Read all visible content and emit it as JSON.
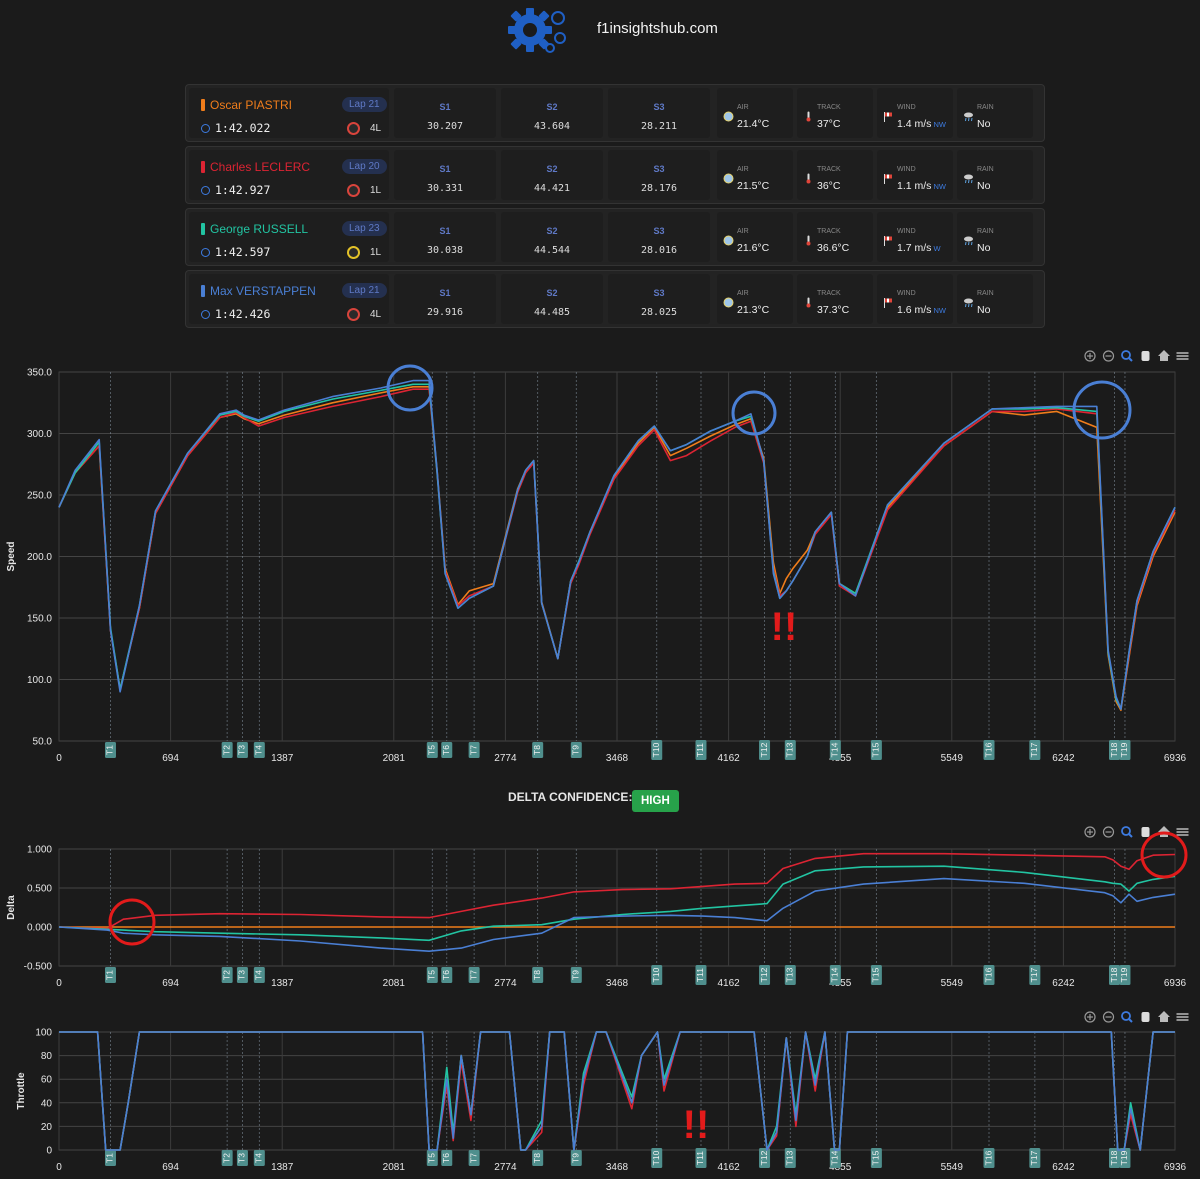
{
  "site": {
    "title": "f1insightshub.com"
  },
  "drivers": [
    {
      "name": "Oscar PIASTRI",
      "color": "#f07d1b",
      "lap": "Lap 21",
      "time": "1:42.022",
      "tyre": "soft",
      "tyre_label": "4L",
      "s1": "30.207",
      "s2": "43.604",
      "s3": "28.211",
      "air": "21.4°C",
      "track": "37°C",
      "wind": "1.4 m/s",
      "wind_dir": "NW",
      "rain": "No"
    },
    {
      "name": "Charles LECLERC",
      "color": "#dc2433",
      "lap": "Lap 20",
      "time": "1:42.927",
      "tyre": "soft",
      "tyre_label": "1L",
      "s1": "30.331",
      "s2": "44.421",
      "s3": "28.176",
      "air": "21.5°C",
      "track": "36°C",
      "wind": "1.1 m/s",
      "wind_dir": "NW",
      "rain": "No"
    },
    {
      "name": "George RUSSELL",
      "color": "#22c4a2",
      "lap": "Lap 23",
      "time": "1:42.597",
      "tyre": "medium",
      "tyre_label": "1L",
      "s1": "30.038",
      "s2": "44.544",
      "s3": "28.016",
      "air": "21.6°C",
      "track": "36.6°C",
      "wind": "1.7 m/s",
      "wind_dir": "W",
      "rain": "No"
    },
    {
      "name": "Max VERSTAPPEN",
      "color": "#4a7fd4",
      "lap": "Lap 21",
      "time": "1:42.426",
      "tyre": "soft",
      "tyre_label": "4L",
      "s1": "29.916",
      "s2": "44.485",
      "s3": "28.025",
      "air": "21.3°C",
      "track": "37.3°C",
      "wind": "1.6 m/s",
      "wind_dir": "NW",
      "rain": "No"
    }
  ],
  "labels": {
    "s1": "S1",
    "s2": "S2",
    "s3": "S3",
    "air": "AIR",
    "track": "TRACK",
    "wind": "WIND",
    "rain": "RAIN"
  },
  "delta_confidence": {
    "label": "DELTA CONFIDENCE:",
    "value": "HIGH"
  },
  "toolbar_icons": [
    "zoom-in-icon",
    "zoom-out-icon",
    "magnifier-icon",
    "pan-hand-icon",
    "home-icon",
    "menu-icon"
  ],
  "annotations": {
    "exclamation": "!!"
  },
  "chart_data": [
    {
      "type": "line",
      "id": "speed",
      "ylabel": "Speed",
      "ylim": [
        50,
        350
      ],
      "yticks": [
        "350.0",
        "300.0",
        "250.0",
        "200.0",
        "150.0",
        "100.0",
        "50.0"
      ],
      "xlim": [
        0,
        6936
      ],
      "xticks": [
        "0",
        "694",
        "1387",
        "2081",
        "2774",
        "3468",
        "4162",
        "4855",
        "5549",
        "6242",
        "6936"
      ],
      "corners": [
        {
          "label": "T1",
          "x": 320
        },
        {
          "label": "T2",
          "x": 1045
        },
        {
          "label": "T3",
          "x": 1140
        },
        {
          "label": "T4",
          "x": 1245
        },
        {
          "label": "T5",
          "x": 2320
        },
        {
          "label": "T6",
          "x": 2410
        },
        {
          "label": "T7",
          "x": 2580
        },
        {
          "label": "T8",
          "x": 2975
        },
        {
          "label": "T9",
          "x": 3215
        },
        {
          "label": "T10",
          "x": 3715
        },
        {
          "label": "T11",
          "x": 3990
        },
        {
          "label": "T12",
          "x": 4385
        },
        {
          "label": "T13",
          "x": 4545
        },
        {
          "label": "T14",
          "x": 4825
        },
        {
          "label": "T15",
          "x": 5080
        },
        {
          "label": "T16",
          "x": 5780
        },
        {
          "label": "T17",
          "x": 6065
        },
        {
          "label": "T18",
          "x": 6560
        },
        {
          "label": "T19",
          "x": 6625
        }
      ],
      "x": [
        0,
        100,
        250,
        320,
        380,
        500,
        600,
        800,
        1000,
        1100,
        1150,
        1240,
        1400,
        1700,
        2000,
        2200,
        2300,
        2350,
        2400,
        2480,
        2550,
        2700,
        2850,
        2900,
        2950,
        3000,
        3100,
        3180,
        3230,
        3300,
        3450,
        3600,
        3700,
        3800,
        3900,
        4050,
        4200,
        4300,
        4380,
        4440,
        4480,
        4520,
        4560,
        4650,
        4700,
        4800,
        4850,
        4950,
        5150,
        5500,
        5800,
        6000,
        6200,
        6450,
        6520,
        6570,
        6600,
        6650,
        6700,
        6800,
        6936
      ],
      "series": [
        {
          "name": "Oscar PIASTRI",
          "color": "#f07d1b",
          "values": [
            240,
            268,
            290,
            140,
            92,
            158,
            235,
            282,
            313,
            316,
            312,
            308,
            315,
            325,
            333,
            338,
            338,
            270,
            190,
            161,
            172,
            178,
            255,
            270,
            278,
            163,
            117,
            180,
            195,
            220,
            265,
            292,
            305,
            282,
            288,
            298,
            307,
            312,
            280,
            195,
            170,
            182,
            190,
            205,
            220,
            236,
            178,
            170,
            240,
            290,
            318,
            315,
            318,
            305,
            120,
            82,
            75,
            118,
            160,
            200,
            236
          ]
        },
        {
          "name": "Charles LECLERC",
          "color": "#dc2433",
          "values": [
            240,
            268,
            290,
            140,
            92,
            158,
            235,
            282,
            313,
            317,
            313,
            306,
            313,
            322,
            330,
            336,
            336,
            268,
            188,
            160,
            168,
            176,
            252,
            268,
            276,
            162,
            117,
            178,
            193,
            218,
            263,
            290,
            303,
            278,
            282,
            294,
            305,
            310,
            276,
            190,
            168,
            172,
            180,
            200,
            218,
            234,
            176,
            168,
            238,
            290,
            318,
            318,
            320,
            316,
            122,
            84,
            76,
            120,
            162,
            202,
            238
          ]
        },
        {
          "name": "George RUSSELL",
          "color": "#22c4a2",
          "values": [
            240,
            268,
            293,
            142,
            92,
            160,
            237,
            284,
            315,
            318,
            314,
            310,
            318,
            328,
            335,
            340,
            340,
            268,
            186,
            158,
            166,
            176,
            254,
            270,
            278,
            162,
            117,
            180,
            196,
            220,
            266,
            294,
            306,
            286,
            291,
            302,
            310,
            314,
            278,
            188,
            166,
            172,
            180,
            200,
            220,
            236,
            178,
            170,
            242,
            292,
            320,
            320,
            321,
            318,
            122,
            84,
            76,
            122,
            164,
            204,
            240
          ]
        },
        {
          "name": "Max VERSTAPPEN",
          "color": "#4a7fd4",
          "values": [
            240,
            270,
            295,
            140,
            90,
            160,
            237,
            284,
            316,
            319,
            315,
            311,
            319,
            330,
            337,
            343,
            343,
            270,
            186,
            158,
            166,
            176,
            254,
            270,
            278,
            162,
            117,
            180,
            195,
            220,
            266,
            294,
            306,
            286,
            291,
            302,
            310,
            316,
            278,
            186,
            166,
            172,
            180,
            200,
            220,
            236,
            178,
            168,
            242,
            292,
            320,
            321,
            322,
            322,
            124,
            86,
            76,
            122,
            164,
            204,
            240
          ]
        }
      ]
    },
    {
      "type": "line",
      "id": "delta",
      "ylabel": "Delta",
      "ylim": [
        -0.5,
        1.0
      ],
      "yticks": [
        "1.000",
        "0.500",
        "0.000",
        "-0.500"
      ],
      "xlim": [
        0,
        6936
      ],
      "xticks": [
        "0",
        "694",
        "1387",
        "2081",
        "2774",
        "3468",
        "4162",
        "4855",
        "5549",
        "6242",
        "6936"
      ],
      "corners": [
        {
          "label": "T1",
          "x": 320
        },
        {
          "label": "T2",
          "x": 1045
        },
        {
          "label": "T3",
          "x": 1140
        },
        {
          "label": "T4",
          "x": 1245
        },
        {
          "label": "T5",
          "x": 2320
        },
        {
          "label": "T6",
          "x": 2410
        },
        {
          "label": "T7",
          "x": 2580
        },
        {
          "label": "T8",
          "x": 2975
        },
        {
          "label": "T9",
          "x": 3215
        },
        {
          "label": "T10",
          "x": 3715
        },
        {
          "label": "T11",
          "x": 3990
        },
        {
          "label": "T12",
          "x": 4385
        },
        {
          "label": "T13",
          "x": 4545
        },
        {
          "label": "T14",
          "x": 4825
        },
        {
          "label": "T15",
          "x": 5080
        },
        {
          "label": "T16",
          "x": 5780
        },
        {
          "label": "T17",
          "x": 6065
        },
        {
          "label": "T18",
          "x": 6560
        },
        {
          "label": "T19",
          "x": 6625
        }
      ],
      "x": [
        0,
        300,
        400,
        600,
        1000,
        1500,
        2000,
        2300,
        2500,
        2700,
        3000,
        3200,
        3500,
        3800,
        4000,
        4200,
        4400,
        4500,
        4700,
        5000,
        5500,
        6000,
        6500,
        6550,
        6600,
        6650,
        6700,
        6800,
        6936
      ],
      "series": [
        {
          "name": "Oscar PIASTRI",
          "color": "#f07d1b",
          "values": [
            0,
            0,
            0,
            0,
            0,
            0,
            0,
            0,
            0,
            0,
            0,
            0,
            0,
            0,
            0,
            0,
            0,
            0,
            0,
            0,
            0,
            0,
            0,
            0,
            0,
            0,
            0,
            0,
            0
          ]
        },
        {
          "name": "Charles LECLERC",
          "color": "#dc2433",
          "values": [
            0,
            -0.02,
            0.1,
            0.15,
            0.17,
            0.16,
            0.13,
            0.12,
            0.2,
            0.28,
            0.37,
            0.45,
            0.48,
            0.49,
            0.52,
            0.55,
            0.56,
            0.75,
            0.88,
            0.94,
            0.94,
            0.92,
            0.9,
            0.86,
            0.78,
            0.74,
            0.85,
            0.92,
            0.93
          ]
        },
        {
          "name": "George RUSSELL",
          "color": "#22c4a2",
          "values": [
            0,
            -0.03,
            -0.04,
            -0.06,
            -0.08,
            -0.1,
            -0.14,
            -0.17,
            -0.05,
            0.01,
            0.03,
            0.1,
            0.16,
            0.2,
            0.24,
            0.27,
            0.3,
            0.55,
            0.72,
            0.77,
            0.78,
            0.7,
            0.58,
            0.56,
            0.55,
            0.46,
            0.56,
            0.61,
            0.65
          ]
        },
        {
          "name": "Max VERSTAPPEN",
          "color": "#4a7fd4",
          "values": [
            0,
            -0.04,
            -0.08,
            -0.1,
            -0.12,
            -0.18,
            -0.27,
            -0.31,
            -0.27,
            -0.16,
            -0.08,
            0.12,
            0.14,
            0.15,
            0.14,
            0.12,
            0.08,
            0.24,
            0.46,
            0.55,
            0.62,
            0.56,
            0.44,
            0.4,
            0.31,
            0.42,
            0.33,
            0.38,
            0.42
          ]
        }
      ]
    },
    {
      "type": "line",
      "id": "throttle",
      "ylabel": "Throttle",
      "ylim": [
        0,
        100
      ],
      "yticks": [
        "100",
        "80",
        "60",
        "40",
        "20",
        "0"
      ],
      "xlim": [
        0,
        6936
      ],
      "xticks": [
        "0",
        "694",
        "1387",
        "2081",
        "2774",
        "3468",
        "4162",
        "4855",
        "5549",
        "6242",
        "6936"
      ],
      "corners": [
        {
          "label": "T1",
          "x": 320
        },
        {
          "label": "T2",
          "x": 1045
        },
        {
          "label": "T3",
          "x": 1140
        },
        {
          "label": "T4",
          "x": 1245
        },
        {
          "label": "T5",
          "x": 2320
        },
        {
          "label": "T6",
          "x": 2410
        },
        {
          "label": "T7",
          "x": 2580
        },
        {
          "label": "T8",
          "x": 2975
        },
        {
          "label": "T9",
          "x": 3215
        },
        {
          "label": "T10",
          "x": 3715
        },
        {
          "label": "T11",
          "x": 3990
        },
        {
          "label": "T12",
          "x": 4385
        },
        {
          "label": "T13",
          "x": 4545
        },
        {
          "label": "T14",
          "x": 4825
        },
        {
          "label": "T15",
          "x": 5080
        },
        {
          "label": "T16",
          "x": 5780
        },
        {
          "label": "T17",
          "x": 6065
        },
        {
          "label": "T18",
          "x": 6560
        },
        {
          "label": "T19",
          "x": 6625
        }
      ],
      "x": [
        0,
        240,
        290,
        380,
        430,
        500,
        2260,
        2300,
        2350,
        2410,
        2450,
        2500,
        2560,
        2620,
        2800,
        2870,
        2900,
        3000,
        3050,
        3140,
        3200,
        3260,
        3340,
        3400,
        3560,
        3620,
        3720,
        3760,
        3860,
        4320,
        4400,
        4460,
        4520,
        4580,
        4640,
        4700,
        4760,
        4820,
        4850,
        4900,
        6540,
        6580,
        6620,
        6660,
        6720,
        6800,
        6936
      ],
      "series": [
        {
          "name": "Oscar PIASTRI",
          "color": "#f07d1b",
          "values": [
            100,
            100,
            0,
            0,
            40,
            100,
            100,
            0,
            0,
            60,
            10,
            80,
            30,
            100,
            100,
            0,
            0,
            20,
            100,
            100,
            0,
            60,
            100,
            100,
            40,
            80,
            100,
            55,
            100,
            100,
            0,
            15,
            95,
            25,
            100,
            55,
            100,
            0,
            0,
            100,
            100,
            0,
            0,
            35,
            0,
            100,
            100
          ]
        },
        {
          "name": "Charles LECLERC",
          "color": "#dc2433",
          "values": [
            100,
            100,
            0,
            0,
            40,
            100,
            100,
            0,
            0,
            55,
            8,
            75,
            25,
            100,
            100,
            0,
            0,
            15,
            100,
            100,
            0,
            55,
            100,
            100,
            35,
            80,
            100,
            50,
            100,
            100,
            0,
            12,
            95,
            20,
            100,
            50,
            100,
            0,
            0,
            100,
            100,
            0,
            0,
            30,
            0,
            100,
            100
          ]
        },
        {
          "name": "George RUSSELL",
          "color": "#22c4a2",
          "values": [
            100,
            100,
            0,
            0,
            40,
            100,
            100,
            0,
            0,
            70,
            15,
            80,
            30,
            100,
            100,
            0,
            0,
            25,
            100,
            100,
            0,
            65,
            100,
            100,
            45,
            80,
            100,
            60,
            100,
            100,
            0,
            20,
            95,
            30,
            100,
            60,
            100,
            0,
            0,
            100,
            100,
            0,
            0,
            40,
            0,
            100,
            100
          ]
        },
        {
          "name": "Max VERSTAPPEN",
          "color": "#4a7fd4",
          "values": [
            100,
            100,
            0,
            0,
            40,
            100,
            100,
            0,
            0,
            60,
            10,
            80,
            30,
            100,
            100,
            0,
            0,
            20,
            100,
            100,
            0,
            60,
            100,
            100,
            40,
            80,
            100,
            55,
            100,
            100,
            0,
            15,
            95,
            25,
            100,
            55,
            100,
            0,
            0,
            100,
            100,
            0,
            0,
            35,
            0,
            100,
            100
          ]
        }
      ]
    }
  ]
}
